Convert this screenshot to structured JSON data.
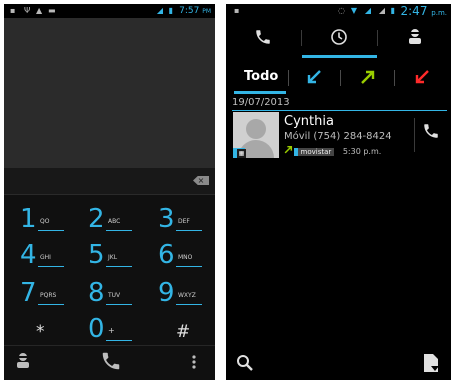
{
  "dialer": {
    "status_time": "7:57",
    "status_ampm": "PM",
    "keys": [
      {
        "digit": "1",
        "letters": "QO"
      },
      {
        "digit": "2",
        "letters": "ABC"
      },
      {
        "digit": "3",
        "letters": "DEF"
      },
      {
        "digit": "4",
        "letters": "GHI"
      },
      {
        "digit": "5",
        "letters": "JKL"
      },
      {
        "digit": "6",
        "letters": "MNO"
      },
      {
        "digit": "7",
        "letters": "PQRS"
      },
      {
        "digit": "8",
        "letters": "TUV"
      },
      {
        "digit": "9",
        "letters": "WXYZ"
      },
      {
        "digit": "*",
        "letters": ""
      },
      {
        "digit": "0",
        "letters": "+"
      },
      {
        "digit": "#",
        "letters": ""
      }
    ],
    "bottom_icons": [
      "contacts-icon",
      "phone-icon",
      "overflow-menu-icon"
    ]
  },
  "call_log": {
    "status_time": "2:47",
    "status_ampm": "p.m.",
    "tabs": [
      "phone-icon",
      "clock-icon",
      "contacts-icon"
    ],
    "selected_tab": 1,
    "filters": {
      "all_label": "Todo",
      "incoming_color": "#33b5e5",
      "outgoing_color": "#99cc00",
      "missed_color": "#ff2a2a"
    },
    "date_header": "19/07/2013",
    "entries": [
      {
        "name": "Cynthia",
        "number": "Móvil (754) 284-8424",
        "carrier": "movistar",
        "time": "5:30 p.m.",
        "call_type": "outgoing"
      }
    ],
    "bottom_icons": [
      "search-icon",
      "filter-icon"
    ]
  },
  "colors": {
    "accent": "#33b5e5",
    "background": "#000000"
  }
}
